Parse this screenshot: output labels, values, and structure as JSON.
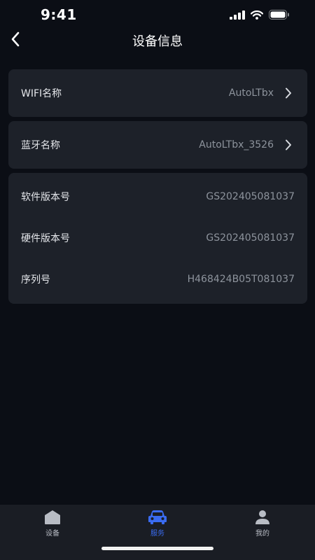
{
  "status": {
    "time": "9:41"
  },
  "header": {
    "title": "设备信息"
  },
  "wifi_card": {
    "label": "WIFI名称",
    "value": "AutoLTbx"
  },
  "bt_card": {
    "label": "蓝牙名称",
    "value": "AutoLTbx_3526"
  },
  "info_card": {
    "rows": [
      {
        "label": "软件版本号",
        "value": "GS202405081037"
      },
      {
        "label": "硬件版本号",
        "value": "GS202405081037"
      },
      {
        "label": "序列号",
        "value": "H468424B05T081037"
      }
    ]
  },
  "tabs": [
    {
      "label": "设备",
      "icon": "home-icon",
      "active": false
    },
    {
      "label": "服务",
      "icon": "car-icon",
      "active": true
    },
    {
      "label": "我的",
      "icon": "person-icon",
      "active": false
    }
  ],
  "colors": {
    "accent": "#3a6bf0",
    "inactive_tab": "#b8bcc4",
    "card": "#1d2129",
    "background": "#0b0e15"
  }
}
